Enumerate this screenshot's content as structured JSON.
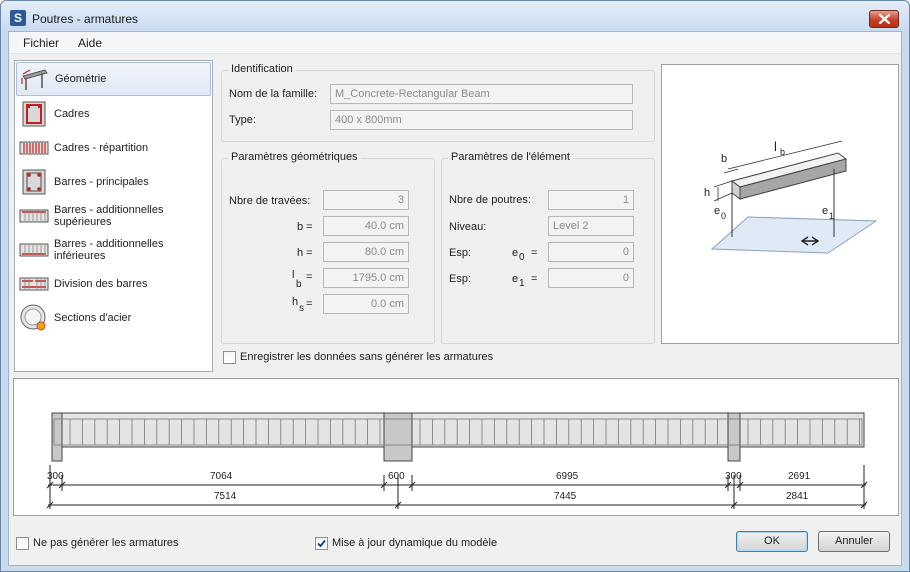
{
  "window": {
    "title": "Poutres - armatures",
    "app_icon_letter": "S"
  },
  "menu": {
    "items": [
      "Fichier",
      "Aide"
    ]
  },
  "sidebar": {
    "items": [
      {
        "label": "Géométrie",
        "icon": "geometry-icon",
        "selected": true
      },
      {
        "label": "Cadres",
        "icon": "stirrups-icon"
      },
      {
        "label": "Cadres - répartition",
        "icon": "stirrup-distribution-icon"
      },
      {
        "label": "Barres - principales",
        "icon": "main-bars-icon"
      },
      {
        "label": "Barres - additionnelles supérieures",
        "icon": "additional-top-bars-icon"
      },
      {
        "label": "Barres - additionnelles inférieures",
        "icon": "additional-bottom-bars-icon"
      },
      {
        "label": "Division des barres",
        "icon": "bar-division-icon"
      },
      {
        "label": "Sections d'acier",
        "icon": "steel-sections-icon"
      }
    ]
  },
  "identification": {
    "title": "Identification",
    "family_label": "Nom de la famille:",
    "family_value": "M_Concrete-Rectangular Beam",
    "type_label": "Type:",
    "type_value": "400 x 800mm"
  },
  "geometry": {
    "title": "Paramètres géométriques",
    "spans_label": "Nbre de travées:",
    "spans_value": "3",
    "b_label": "b =",
    "b_value": "40.0 cm",
    "h_label": "h =",
    "h_value": "80.0 cm",
    "lb_label": "l",
    "lb_sub": "b",
    "lb_eq": "=",
    "lb_value": "1795.0 cm",
    "hs_label": "h",
    "hs_sub": "s",
    "hs_eq": "=",
    "hs_value": "0.0 cm"
  },
  "element": {
    "title": "Paramètres de l'élément",
    "beams_label": "Nbre de poutres:",
    "beams_value": "1",
    "level_label": "Niveau:",
    "level_value": "Level 2",
    "esp1_label": "Esp:",
    "e0_label": "e",
    "e0_sub": "0",
    "e0_eq": "=",
    "e0_value": "0",
    "esp2_label": "Esp:",
    "e1_label": "e",
    "e1_sub": "1",
    "e1_eq": "=",
    "e1_value": "0"
  },
  "diagram_labels": {
    "b": "b",
    "lb": "l",
    "lb_sub": "b",
    "h": "h",
    "e0": "e",
    "e0_sub": "0",
    "e1": "e",
    "e1_sub": "1"
  },
  "save_without_generating": {
    "label": "Enregistrer les données sans générer les armatures",
    "checked": false
  },
  "beam_view": {
    "dims_top": [
      "300",
      "7064",
      "600",
      "6995",
      "300",
      "2691"
    ],
    "dims_bottom": [
      "7514",
      "7445",
      "2841"
    ]
  },
  "bottom": {
    "no_generate_label": "Ne pas générer les armatures",
    "no_generate_checked": false,
    "dynamic_update_label": "Mise à jour dynamique du modèle",
    "dynamic_update_checked": true,
    "ok_label": "OK",
    "cancel_label": "Annuler"
  }
}
